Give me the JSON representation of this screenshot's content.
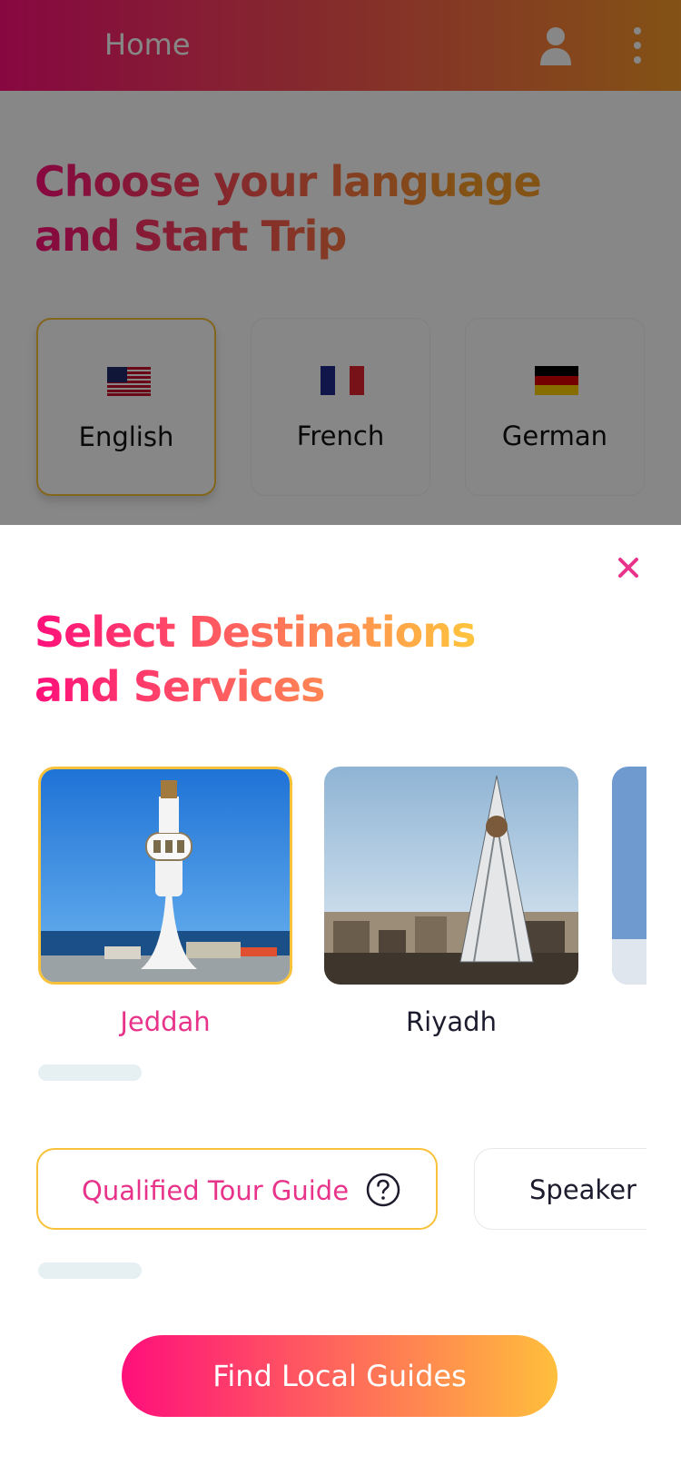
{
  "appbar": {
    "title": "Home",
    "icons": [
      "user-icon",
      "more-vert-icon"
    ]
  },
  "language_section": {
    "headline": "Choose your language and Start Trip",
    "headline_line1": "Choose your language",
    "headline_line2": "and Start Trip",
    "languages": [
      {
        "label": "English",
        "flag": "us-flag-icon",
        "selected": true
      },
      {
        "label": "French",
        "flag": "fr-flag-icon",
        "selected": false
      },
      {
        "label": "German",
        "flag": "de-flag-icon",
        "selected": false
      }
    ]
  },
  "sheet": {
    "title_line1": "Select Destinations",
    "title_line2": "and Services",
    "close_icon": "close-icon",
    "destinations": [
      {
        "label": "Jeddah",
        "selected": true
      },
      {
        "label": "Riyadh",
        "selected": false
      }
    ],
    "services": [
      {
        "label": "Qualified Tour Guide",
        "selected": true,
        "icon": "help-circle-icon"
      },
      {
        "label": "Speaker",
        "selected": false
      }
    ],
    "cta": "Find Local Guides"
  },
  "colors": {
    "gradient_start": "#ff0f7b",
    "gradient_end": "#f89b29",
    "selected_border": "#f8c13a",
    "active_text": "#e8338a"
  }
}
